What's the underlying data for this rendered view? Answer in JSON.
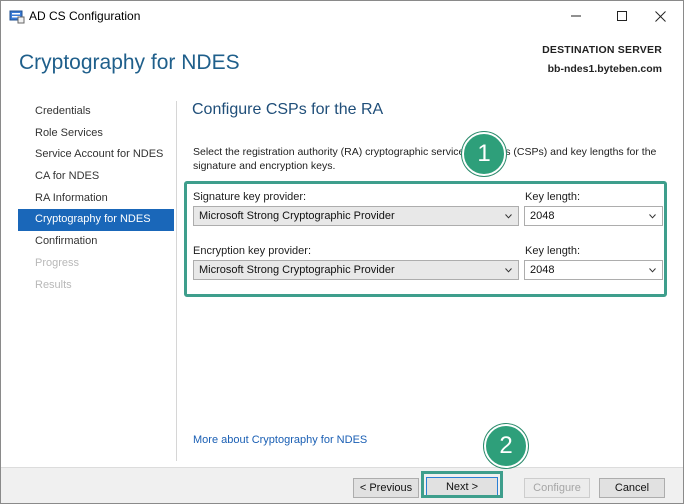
{
  "window": {
    "title": "AD CS Configuration",
    "controls": {
      "minimize": "minimize",
      "maximize": "maximize",
      "close": "close"
    }
  },
  "header": {
    "page_title": "Cryptography for NDES",
    "destination_label": "DESTINATION SERVER",
    "destination_server": "bb-ndes1.byteben.com"
  },
  "nav": {
    "items": [
      {
        "label": "Credentials",
        "state": "normal"
      },
      {
        "label": "Role Services",
        "state": "normal"
      },
      {
        "label": "Service Account for NDES",
        "state": "normal"
      },
      {
        "label": "CA for NDES",
        "state": "normal"
      },
      {
        "label": "RA Information",
        "state": "normal"
      },
      {
        "label": "Cryptography for NDES",
        "state": "selected"
      },
      {
        "label": "Confirmation",
        "state": "normal"
      },
      {
        "label": "Progress",
        "state": "disabled"
      },
      {
        "label": "Results",
        "state": "disabled"
      }
    ]
  },
  "content": {
    "section_title": "Configure CSPs for the RA",
    "description": "Select the registration authority (RA) cryptographic service providers (CSPs) and key lengths for the signature and encryption keys.",
    "signature": {
      "provider_label": "Signature key provider:",
      "provider_value": "Microsoft Strong Cryptographic Provider",
      "key_length_label": "Key length:",
      "key_length_value": "2048"
    },
    "encryption": {
      "provider_label": "Encryption key provider:",
      "provider_value": "Microsoft Strong Cryptographic Provider",
      "key_length_label": "Key length:",
      "key_length_value": "2048"
    },
    "more_link": "More about Cryptography for NDES"
  },
  "footer": {
    "previous": "< Previous",
    "next": "Next >",
    "configure": "Configure",
    "cancel": "Cancel"
  },
  "callouts": {
    "one": "1",
    "two": "2"
  },
  "colors": {
    "accent": "#1a67b9",
    "title": "#1f5f8b",
    "highlight": "#3e9e8c",
    "badge": "#2e9f7a"
  }
}
